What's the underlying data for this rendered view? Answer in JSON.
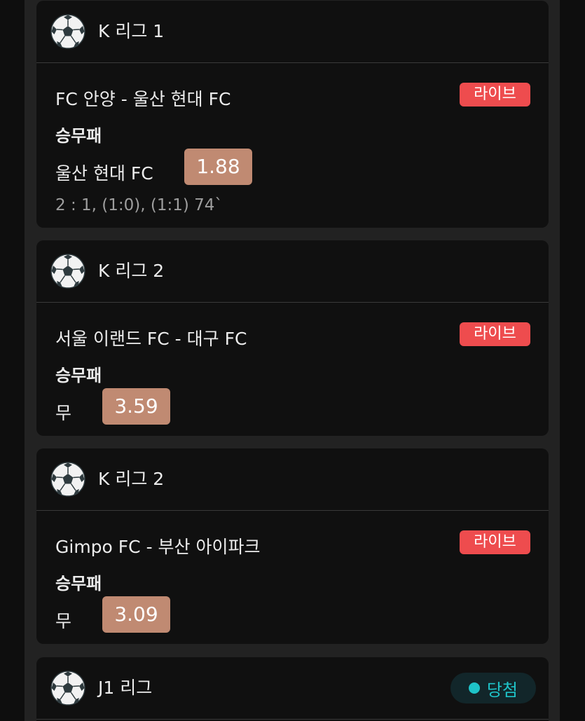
{
  "cards": [
    {
      "league": "K 리그 1",
      "match": "FC 안양 - 울산 현대 FC",
      "badge": "라이브",
      "market": "승무패",
      "pick": "울산 현대 FC",
      "odds": "1.88",
      "score": "2 : 1, (1:0), (1:1) 74`"
    },
    {
      "league": "K 리그 2",
      "match": "서울 이랜드 FC - 대구 FC",
      "badge": "라이브",
      "market": "승무패",
      "pick": "무",
      "odds": "3.59"
    },
    {
      "league": "K 리그 2",
      "match": "Gimpo FC - 부산 아이파크",
      "badge": "라이브",
      "market": "승무패",
      "pick": "무",
      "odds": "3.09"
    },
    {
      "league": "J1 리그",
      "status": "당첨"
    }
  ],
  "icons": {
    "league": "soccer-ball-icon",
    "status_dot": "status-dot-icon"
  },
  "colors": {
    "live_badge": "#ee4c4e",
    "odds_box": "#c08a72",
    "win_status": "#1ec3c8"
  }
}
